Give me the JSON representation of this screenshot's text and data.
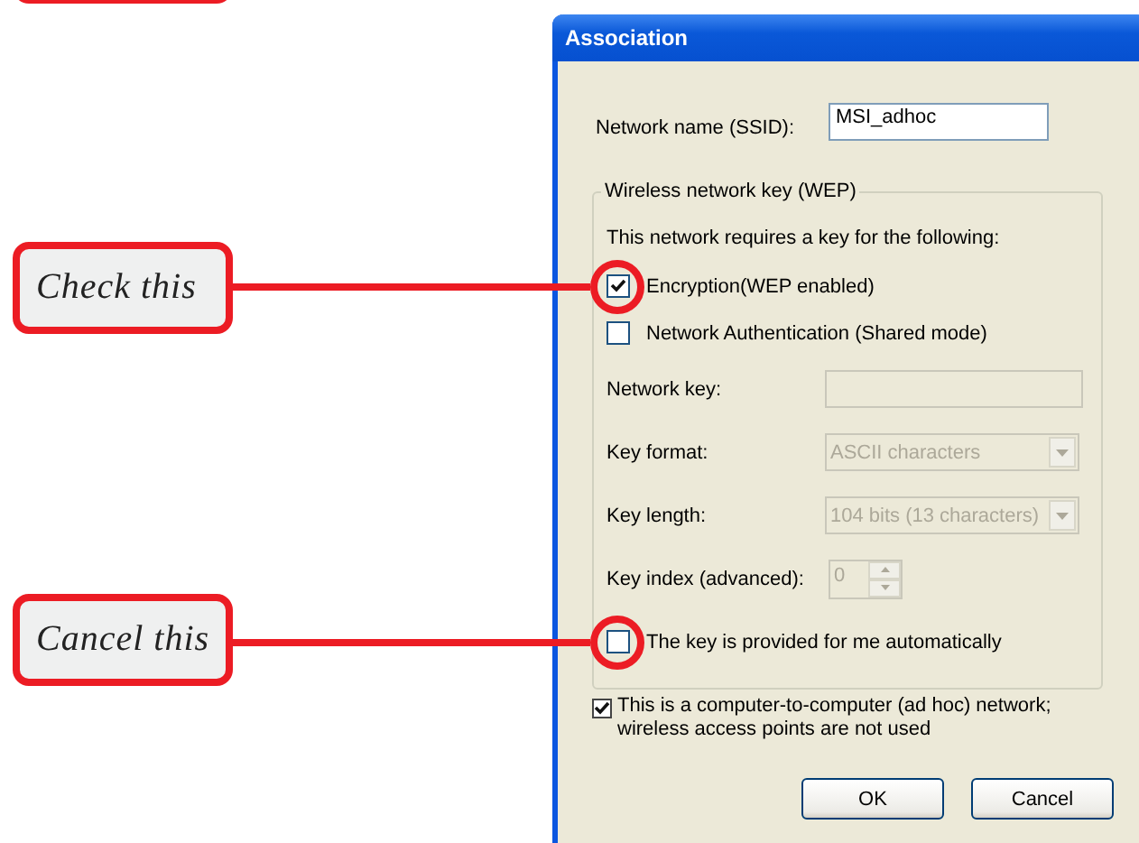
{
  "callouts": [
    {
      "text": "Check this"
    },
    {
      "text": "Cancel this"
    }
  ],
  "dialog": {
    "title": "Association",
    "ssid": {
      "label": "Network name (SSID):",
      "value": "MSI_adhoc"
    },
    "wep_group": {
      "legend": "Wireless network key (WEP)",
      "intro": "This network requires a key for the following:",
      "options": [
        {
          "label": "Encryption(WEP enabled)",
          "checked": true
        },
        {
          "label": "Network Authentication (Shared mode)",
          "checked": false
        }
      ],
      "fields": [
        {
          "kind": "text",
          "label": "Network key:",
          "disabled": true
        },
        {
          "kind": "select",
          "label": "Key format:",
          "value": "ASCII characters",
          "disabled": true
        },
        {
          "kind": "select",
          "label": "Key length:",
          "value": "104 bits (13 characters)",
          "disabled": true
        },
        {
          "kind": "spin",
          "label": "Key index (advanced):",
          "value": "0",
          "disabled": true
        }
      ],
      "auto_key": {
        "label": "The key is provided for me automatically",
        "checked": false
      }
    },
    "adhoc": {
      "label": "This is a computer-to-computer (ad hoc) network; wireless access points are not used",
      "checked": true
    },
    "buttons": [
      "OK",
      "Cancel"
    ]
  }
}
